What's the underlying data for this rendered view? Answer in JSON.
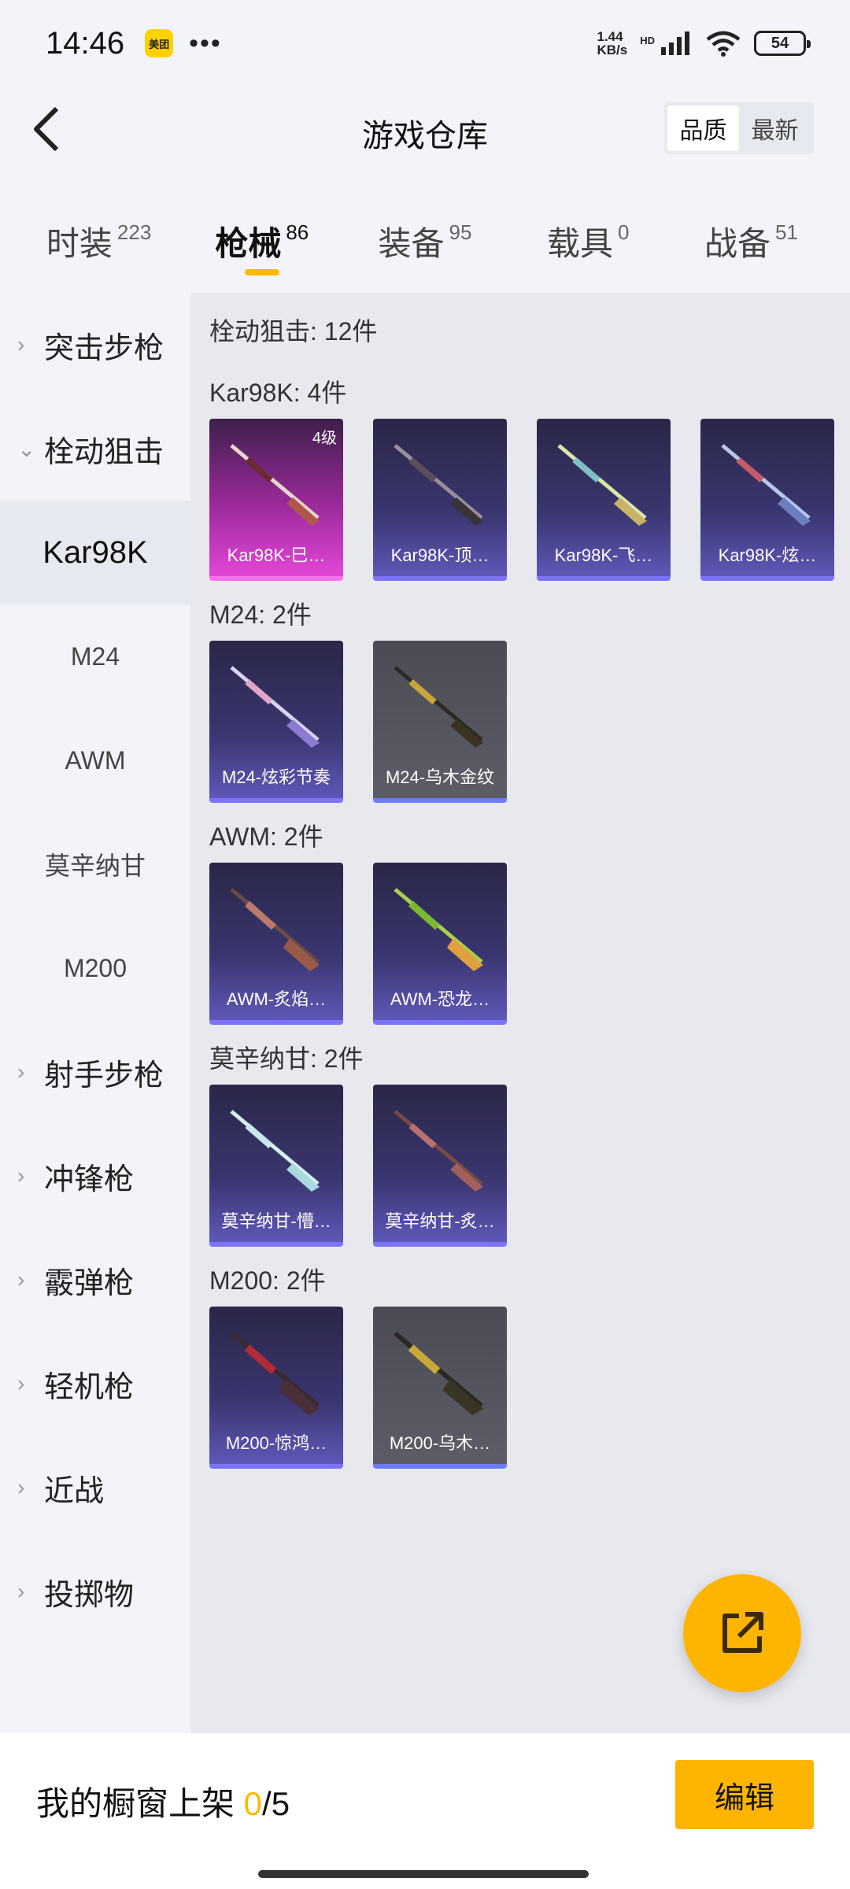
{
  "status": {
    "time": "14:46",
    "badge": "美团",
    "dots": "•••",
    "speed_top": "1.44",
    "speed_bottom": "KB/s",
    "hd": "HD",
    "battery": "54"
  },
  "header": {
    "title": "游戏仓库",
    "sort": {
      "quality": "品质",
      "newest": "最新"
    }
  },
  "tabs": [
    {
      "label": "时装",
      "count": "223"
    },
    {
      "label": "枪械",
      "count": "86"
    },
    {
      "label": "装备",
      "count": "95"
    },
    {
      "label": "载具",
      "count": "0"
    },
    {
      "label": "战备",
      "count": "51"
    }
  ],
  "sidebar": {
    "assault": "突击步枪",
    "bolt": "栓动狙击",
    "sub": [
      "Kar98K",
      "M24",
      "AWM",
      "莫辛纳甘",
      "M200"
    ],
    "marksman": "射手步枪",
    "smg": "冲锋枪",
    "shotgun": "霰弹枪",
    "lmg": "轻机枪",
    "melee": "近战",
    "throwable": "投掷物"
  },
  "content": {
    "summary": "栓动狙击: 12件",
    "groups": [
      {
        "title": "Kar98K: 4件",
        "items": [
          {
            "name": "Kar98K-巳…",
            "level": "4级"
          },
          {
            "name": "Kar98K-顶…"
          },
          {
            "name": "Kar98K-飞…"
          },
          {
            "name": "Kar98K-炫…"
          }
        ]
      },
      {
        "title": "M24: 2件",
        "items": [
          {
            "name": "M24-炫彩节奏"
          },
          {
            "name": "M24-乌木金纹"
          }
        ]
      },
      {
        "title": "AWM: 2件",
        "items": [
          {
            "name": "AWM-炙焰…"
          },
          {
            "name": "AWM-恐龙…"
          }
        ]
      },
      {
        "title": "莫辛纳甘: 2件",
        "items": [
          {
            "name": "莫辛纳甘-懵…"
          },
          {
            "name": "莫辛纳甘-炙…"
          }
        ]
      },
      {
        "title": "M200: 2件",
        "items": [
          {
            "name": "M200-惊鸿…"
          },
          {
            "name": "M200-乌木…"
          }
        ]
      }
    ]
  },
  "bottom": {
    "shelf_label": "我的橱窗上架 ",
    "shelf_current": "0",
    "shelf_total": "/5",
    "edit": "编辑"
  },
  "colors": {
    "accent": "#ffb400",
    "purple_rarity": "#7d73ff",
    "pink_rarity": "#e246d6"
  }
}
